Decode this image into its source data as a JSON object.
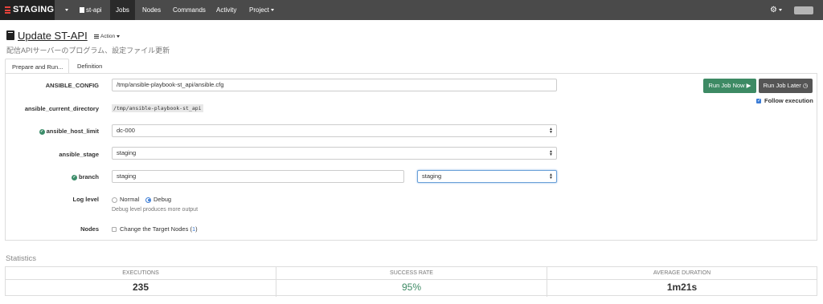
{
  "navbar": {
    "brand": "STAGING",
    "dropdown_caret": "",
    "project_icon": "document-icon",
    "project": "st-api",
    "items": [
      {
        "label": "Jobs",
        "active": true
      },
      {
        "label": "Nodes",
        "active": false
      },
      {
        "label": "Commands",
        "active": false
      },
      {
        "label": "Activity",
        "active": false
      },
      {
        "label": "Project",
        "active": false
      }
    ],
    "settings_icon": "gear-icon"
  },
  "job": {
    "title": "Update ST-API",
    "action_label": "Action",
    "description": "配信APIサーバーのプログラム、設定ファイル更新"
  },
  "tabs": [
    "Prepare and Run...",
    "Definition"
  ],
  "form": {
    "ansible_config": {
      "label": "ANSIBLE_CONFIG",
      "value": "/tmp/ansible-playbook-st_api/ansible.cfg"
    },
    "ansible_current_directory": {
      "label": "ansible_current_directory",
      "value": "/tmp/ansible-playbook-st_api"
    },
    "ansible_host_limit": {
      "label": "ansible_host_limit",
      "value": "dc-000"
    },
    "ansible_stage": {
      "label": "ansible_stage",
      "value": "staging"
    },
    "branch": {
      "label": "branch",
      "text_value": "staging",
      "select_value": "staging"
    },
    "log_level": {
      "label": "Log level",
      "options": [
        "Normal",
        "Debug"
      ],
      "selected": "Debug",
      "hint": "Debug level produces more output"
    },
    "nodes": {
      "label": "Nodes",
      "checkbox_label": "Change the Target Nodes",
      "open_paren": "(",
      "count": "1",
      "close_paren": ")"
    }
  },
  "actions": {
    "run_now": "Run Job Now",
    "run_later": "Run Job Later",
    "follow_execution": "Follow execution",
    "follow_checked": true
  },
  "statistics": {
    "title": "Statistics",
    "items": [
      {
        "label": "EXECUTIONS",
        "value": "235"
      },
      {
        "label": "SUCCESS RATE",
        "value": "95%"
      },
      {
        "label": "AVERAGE DURATION",
        "value": "1m21s"
      }
    ]
  },
  "colors": {
    "navbar_bg": "#4a4a4a",
    "brand_accent": "#e8433b",
    "success_green": "#3d8a64",
    "link_blue": "#3b7cd6"
  }
}
